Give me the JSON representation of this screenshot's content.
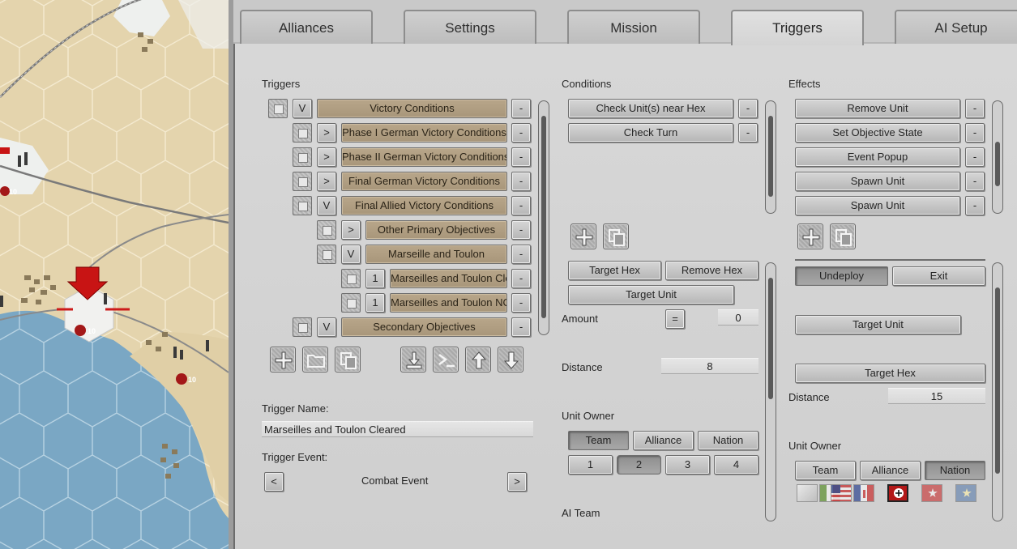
{
  "tabs": [
    {
      "label": "Alliances"
    },
    {
      "label": "Settings"
    },
    {
      "label": "Mission"
    },
    {
      "label": "Triggers"
    },
    {
      "label": "AI Setup"
    }
  ],
  "active_tab": "Triggers",
  "triggers": {
    "title": "Triggers",
    "rows": [
      {
        "toggle": "V",
        "label": "Victory Conditions",
        "remove": "-"
      },
      {
        "toggle": ">",
        "label": "Phase I German Victory Conditions",
        "remove": "-"
      },
      {
        "toggle": ">",
        "label": "Phase II German Victory Conditions",
        "remove": "-"
      },
      {
        "toggle": ">",
        "label": "Final German Victory Conditions",
        "remove": "-"
      },
      {
        "toggle": "V",
        "label": "Final Allied Victory Conditions",
        "remove": "-"
      },
      {
        "toggle": ">",
        "label": "Other Primary Objectives",
        "remove": "-"
      },
      {
        "toggle": "V",
        "label": "Marseille and Toulon",
        "remove": "-"
      },
      {
        "toggle": "1",
        "label": "Marseilles and Toulon Cleared",
        "remove": "-"
      },
      {
        "toggle": "1",
        "label": "Marseilles and Toulon NOT Cleared",
        "remove": "-"
      },
      {
        "toggle": "V",
        "label": "Secondary Objectives",
        "remove": "-"
      }
    ],
    "name_label": "Trigger Name:",
    "name_value": "Marseilles and Toulon Cleared",
    "event_label": "Trigger Event:",
    "event_value": "Combat Event",
    "prev": "<",
    "next": ">"
  },
  "conditions": {
    "title": "Conditions",
    "items": [
      "Check Unit(s) near Hex",
      "Check Turn"
    ],
    "remove": "-",
    "target_hex": "Target Hex",
    "remove_hex": "Remove Hex",
    "target_unit": "Target Unit",
    "amount_label": "Amount",
    "amount_op": "=",
    "amount_value": "0",
    "distance_label": "Distance",
    "distance_value": "8",
    "owner_label": "Unit Owner",
    "owner_tabs": [
      "Team",
      "Alliance",
      "Nation"
    ],
    "owner_selected": "Team",
    "team_numbers": [
      "1",
      "2",
      "3",
      "4"
    ],
    "team_selected": "2",
    "ai_team_label": "AI Team"
  },
  "effects": {
    "title": "Effects",
    "items": [
      "Remove Unit",
      "Set Objective State",
      "Event Popup",
      "Spawn Unit",
      "Spawn Unit"
    ],
    "remove": "-",
    "undeploy": "Undeploy",
    "exit": "Exit",
    "target_unit": "Target Unit",
    "target_hex": "Target Hex",
    "distance_label": "Distance",
    "distance_value": "15",
    "owner_label": "Unit Owner",
    "owner_tabs": [
      "Team",
      "Alliance",
      "Nation"
    ],
    "owner_selected": "Nation",
    "flags": [
      "placeholder-flag-icon",
      "italy-flag-icon",
      "usa-flag-icon",
      "free-france-flag-icon",
      "germany-flag-icon",
      "red-star-flag-icon",
      "blue-star-flag-icon"
    ],
    "selected_flag": "germany-flag-icon"
  },
  "map": {
    "unit_strengths": [
      "10",
      "10",
      "10"
    ],
    "colors": {
      "land": "#e4d4ad",
      "sea": "#7aa7c4",
      "snow": "#eef0ee"
    }
  }
}
